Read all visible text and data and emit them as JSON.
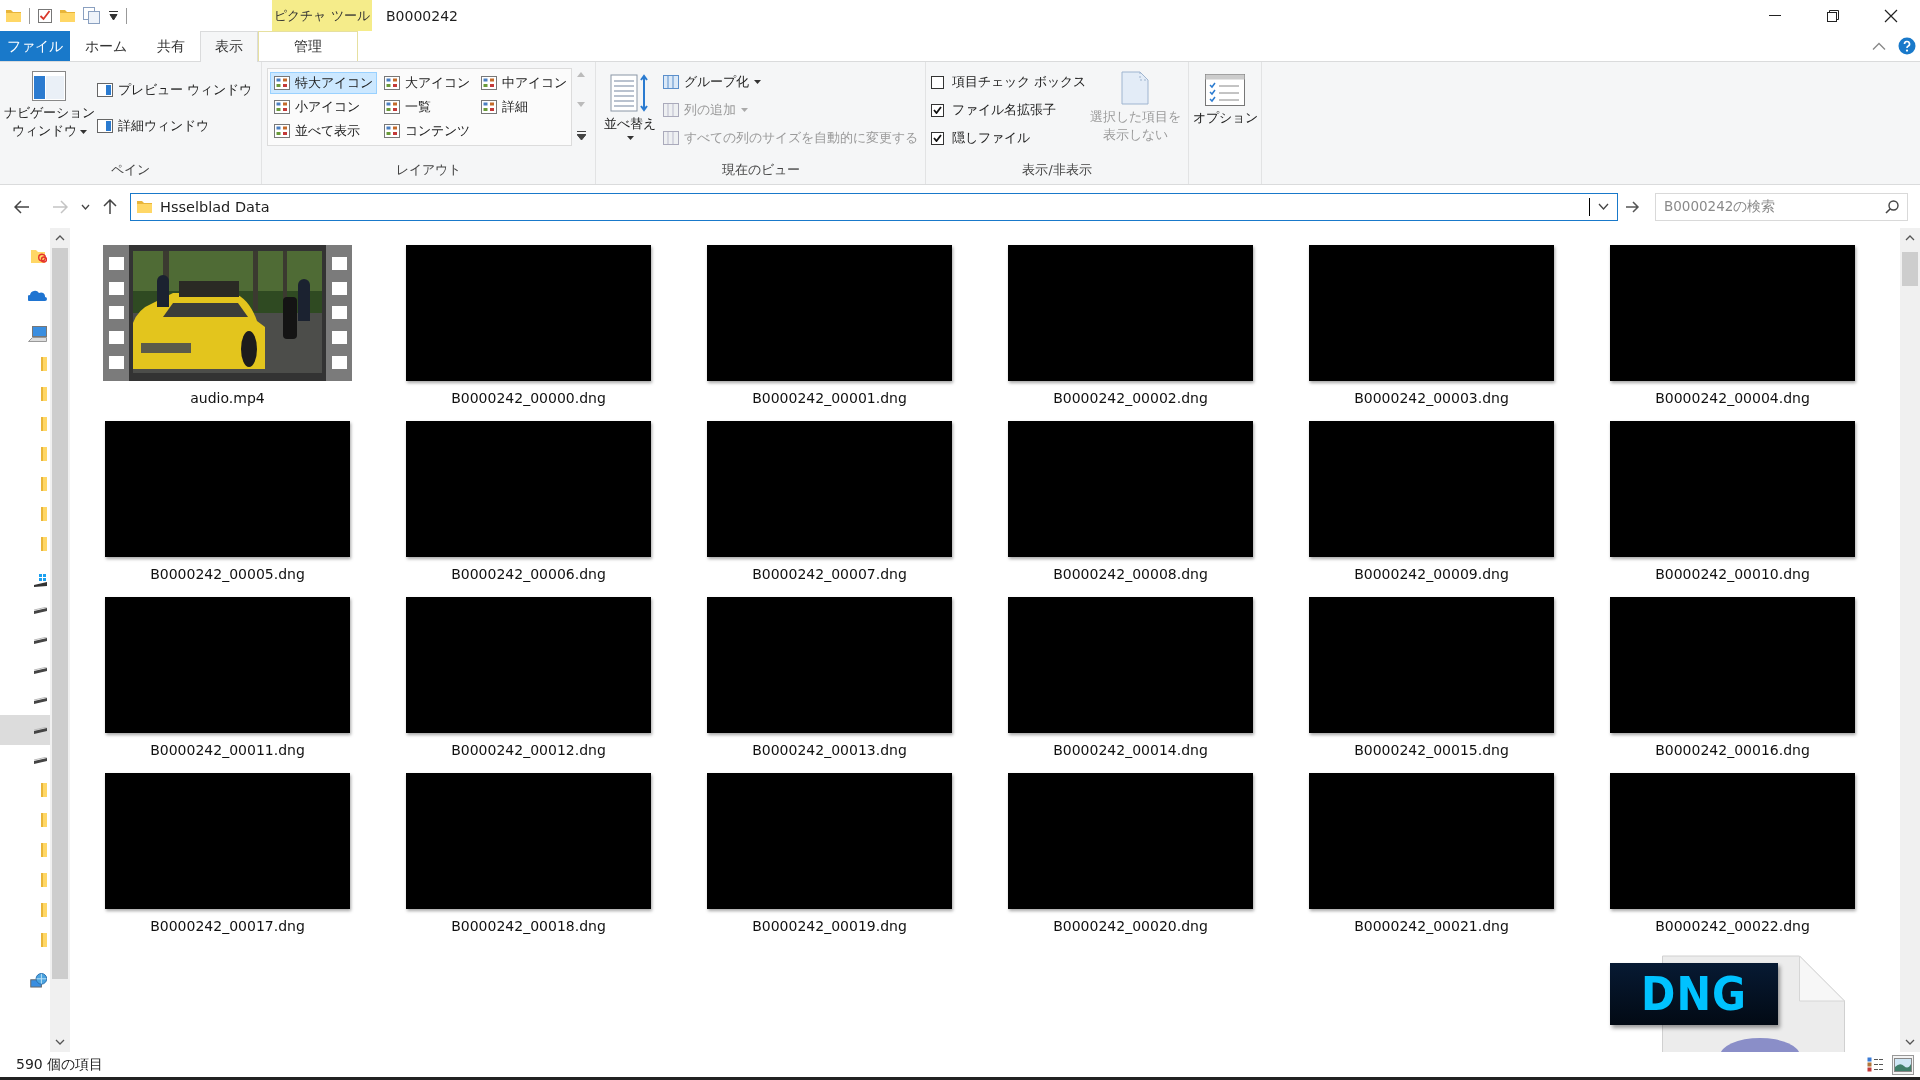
{
  "window": {
    "title": "B0000242",
    "context_group": "ピクチャ ツール"
  },
  "tabs": [
    {
      "label": "ファイル",
      "kind": "file",
      "selected": false
    },
    {
      "label": "ホーム",
      "kind": "normal",
      "selected": false
    },
    {
      "label": "共有",
      "kind": "normal",
      "selected": false
    },
    {
      "label": "表示",
      "kind": "normal",
      "selected": true
    },
    {
      "label": "管理",
      "kind": "contextual",
      "selected": false
    }
  ],
  "ribbon": {
    "pane": {
      "label": "ペイン",
      "navigation_pane": [
        "ナビゲーション",
        "ウィンドウ"
      ],
      "preview_pane": "プレビュー ウィンドウ",
      "details_pane": "詳細ウィンドウ"
    },
    "layout": {
      "label": "レイアウト",
      "options": [
        {
          "label": "特大アイコン",
          "selected": true
        },
        {
          "label": "大アイコン",
          "selected": false
        },
        {
          "label": "中アイコン",
          "selected": false
        },
        {
          "label": "小アイコン",
          "selected": false
        },
        {
          "label": "一覧",
          "selected": false
        },
        {
          "label": "詳細",
          "selected": false
        },
        {
          "label": "並べて表示",
          "selected": false
        },
        {
          "label": "コンテンツ",
          "selected": false
        }
      ]
    },
    "current_view": {
      "label": "現在のビュー",
      "sort": "並べ替え",
      "commands": [
        {
          "label": "グループ化",
          "disabled": false,
          "dropdown": true
        },
        {
          "label": "列の追加",
          "disabled": true,
          "dropdown": true
        },
        {
          "label": "すべての列のサイズを自動的に変更する",
          "disabled": true,
          "dropdown": false
        }
      ]
    },
    "show_hide": {
      "label": "表示/非表示",
      "checkboxes": [
        {
          "label": "項目チェック ボックス",
          "checked": false
        },
        {
          "label": "ファイル名拡張子",
          "checked": true
        },
        {
          "label": "隠しファイル",
          "checked": true
        }
      ],
      "hide_selected": {
        "lines": [
          "選択した項目を",
          "表示しない"
        ],
        "disabled": true
      }
    },
    "options": {
      "label": "オプション"
    }
  },
  "address_bar": {
    "path": "Hsselblad Data",
    "search_placeholder": "B0000242の検索",
    "forward_disabled": true
  },
  "navigation_pane": {
    "items": [
      {
        "kind": "cc-folder",
        "selected": false
      },
      {
        "kind": "cloud",
        "selected": false
      },
      {
        "kind": "pc",
        "selected": false
      },
      {
        "kind": "folder",
        "selected": false
      },
      {
        "kind": "folder",
        "selected": false
      },
      {
        "kind": "folder",
        "selected": false
      },
      {
        "kind": "folder",
        "selected": false
      },
      {
        "kind": "folder",
        "selected": false
      },
      {
        "kind": "folder",
        "selected": false
      },
      {
        "kind": "folder",
        "selected": false
      },
      {
        "kind": "windows-drive",
        "selected": false
      },
      {
        "kind": "drive",
        "selected": false
      },
      {
        "kind": "drive",
        "selected": false
      },
      {
        "kind": "drive",
        "selected": false
      },
      {
        "kind": "drive",
        "selected": false
      },
      {
        "kind": "drive",
        "selected": true
      },
      {
        "kind": "drive",
        "selected": false
      },
      {
        "kind": "folder",
        "selected": false
      },
      {
        "kind": "folder",
        "selected": false
      },
      {
        "kind": "folder",
        "selected": false
      },
      {
        "kind": "folder",
        "selected": false
      },
      {
        "kind": "folder",
        "selected": false
      },
      {
        "kind": "folder",
        "selected": false
      },
      {
        "kind": "network",
        "selected": false
      }
    ]
  },
  "files": [
    {
      "name": "audio.mp4",
      "kind": "video"
    },
    {
      "name": "B0000242_00000.dng"
    },
    {
      "name": "B0000242_00001.dng"
    },
    {
      "name": "B0000242_00002.dng"
    },
    {
      "name": "B0000242_00003.dng"
    },
    {
      "name": "B0000242_00004.dng"
    },
    {
      "name": "B0000242_00005.dng"
    },
    {
      "name": "B0000242_00006.dng"
    },
    {
      "name": "B0000242_00007.dng"
    },
    {
      "name": "B0000242_00008.dng"
    },
    {
      "name": "B0000242_00009.dng"
    },
    {
      "name": "B0000242_00010.dng"
    },
    {
      "name": "B0000242_00011.dng"
    },
    {
      "name": "B0000242_00012.dng"
    },
    {
      "name": "B0000242_00013.dng"
    },
    {
      "name": "B0000242_00014.dng"
    },
    {
      "name": "B0000242_00015.dng"
    },
    {
      "name": "B0000242_00016.dng"
    },
    {
      "name": "B0000242_00017.dng"
    },
    {
      "name": "B0000242_00018.dng"
    },
    {
      "name": "B0000242_00019.dng"
    },
    {
      "name": "B0000242_00020.dng"
    },
    {
      "name": "B0000242_00021.dng"
    },
    {
      "name": "B0000242_00022.dng"
    },
    {
      "kind": "file-type-icon",
      "badge": "DNG"
    }
  ],
  "status_bar": {
    "item_count": "590 個の項目",
    "views": [
      {
        "kind": "details",
        "selected": false
      },
      {
        "kind": "large-icons",
        "selected": true
      }
    ]
  }
}
